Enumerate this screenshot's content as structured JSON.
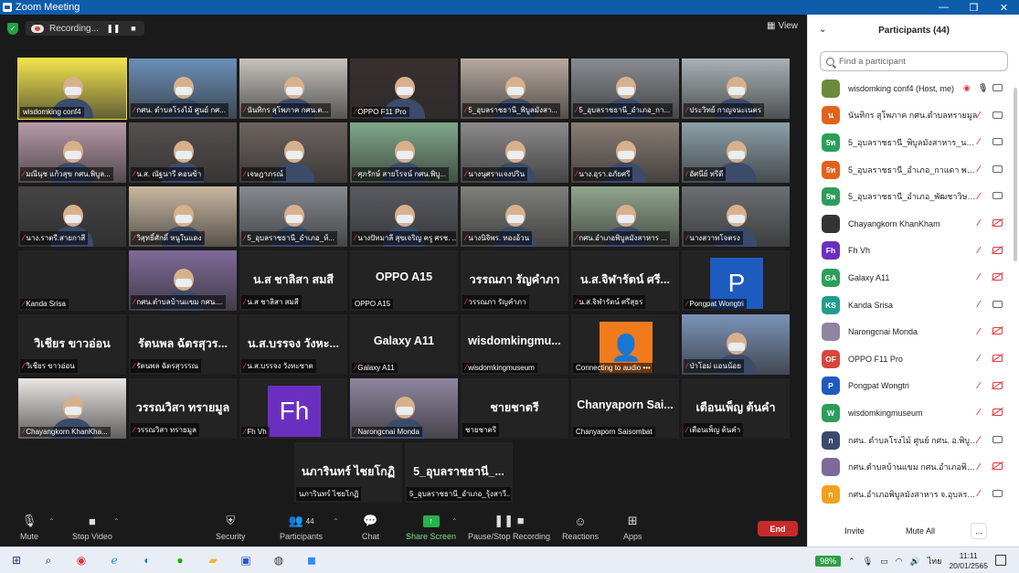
{
  "window": {
    "title": "Zoom Meeting",
    "controls": [
      "—",
      "❐",
      "✕"
    ]
  },
  "recording": {
    "label": "Recording..."
  },
  "view_button": {
    "label": "View"
  },
  "tiles": [
    {
      "name": "wisdomking conf4",
      "kind": "video",
      "bg": "#f2e44e",
      "active": true,
      "muted": false
    },
    {
      "name": "กศน. ตำบลโรงไม้ ศูนย์ กศ...",
      "kind": "video",
      "bg": "#6a8fb8",
      "muted": true
    },
    {
      "name": "นันทิกร สุโพภาค กศน.ต...",
      "kind": "video",
      "bg": "#c6c3bd",
      "muted": true
    },
    {
      "name": "OPPO F11 Pro",
      "kind": "video",
      "bg": "#3a2f2f",
      "muted": true
    },
    {
      "name": "5_อุบลราชธานี_พิบูลมังสา...",
      "kind": "video",
      "bg": "#b8aaa0",
      "muted": true
    },
    {
      "name": "5_อุบลราชธานี_อำเภอ_กา...",
      "kind": "video",
      "bg": "#8a8c93",
      "muted": true
    },
    {
      "name": "ประวิทย์ กาญจนะเนตร",
      "kind": "video",
      "bg": "#a9b2b7",
      "muted": true
    },
    {
      "name": "มณีนุช แก้วสุข กศน.พิบูล...",
      "kind": "video",
      "bg": "#b89aa9",
      "muted": true
    },
    {
      "name": "น.ส. ณัฐนารี คอนข้า",
      "kind": "video",
      "bg": "#565050",
      "muted": true
    },
    {
      "name": "เจษฎาภรณ์",
      "kind": "video",
      "bg": "#6d6360",
      "muted": true
    },
    {
      "name": "ศุภรักษ์ สายโรจน์ กศน.พิบู...",
      "kind": "video",
      "bg": "#7fa88a",
      "muted": true
    },
    {
      "name": "นางนุศราแจงปริน",
      "kind": "video",
      "bg": "#8c8a8a",
      "muted": true
    },
    {
      "name": "นาง.อุรา.อภัยศรี",
      "kind": "video",
      "bg": "#8a7d74",
      "muted": true
    },
    {
      "name": "อัศนีย์ หรีดี",
      "kind": "video",
      "bg": "#8da0a8",
      "muted": true
    },
    {
      "name": "นาง.ราตรี.สายกาสี",
      "kind": "video",
      "bg": "#454444",
      "muted": true
    },
    {
      "name": "วิสุทธิ์ศักดิ์ หนูในแดง",
      "kind": "video",
      "bg": "#c8b7a0",
      "muted": true
    },
    {
      "name": "5_อุบลราชธานี_อำเภอ_ห้...",
      "kind": "video",
      "bg": "#878a90",
      "muted": true
    },
    {
      "name": "นางปัทมาลี สุขเจริญ ครู ศรช. ...",
      "kind": "video",
      "bg": "#5a5c62",
      "muted": true
    },
    {
      "name": "นางนิจิพร. ทองอ้วน",
      "kind": "video",
      "bg": "#7f7f7c",
      "muted": true
    },
    {
      "name": "กศน.อำเภอพิบูลมังสาหาร ...",
      "kind": "video",
      "bg": "#90a68e",
      "muted": true
    },
    {
      "name": "นางสวาทโจตรง",
      "kind": "video",
      "bg": "#6c6f73",
      "muted": true
    },
    {
      "name": "Kanda Srisa",
      "kind": "blank",
      "muted": true
    },
    {
      "name": "กศน.ตำบลบ้านแขม กศน....",
      "kind": "video",
      "bg": "#7e6a99",
      "muted": true
    },
    {
      "name": "น.ส ชาลิสา สมสี",
      "kind": "text",
      "big": "น.ส ชาลิสา สมสี",
      "muted": true
    },
    {
      "name": "OPPO A15",
      "kind": "text",
      "big": "OPPO A15",
      "muted": false
    },
    {
      "name": "วรรณภา รัญคำภา",
      "kind": "text",
      "big": "วรรณภา รัญคำภา",
      "muted": true
    },
    {
      "name": "น.ส.จิฬารัตน์ ศรีสุธร",
      "kind": "text",
      "big": "น.ส.จิฬารัตน์ ศรี...",
      "muted": true
    },
    {
      "name": "Pongpat Wongtri",
      "kind": "avatar",
      "letter": "P",
      "bg": "#1d5bbf",
      "muted": true
    },
    {
      "name": "วิเชียร ขาวอ่อน",
      "kind": "text",
      "big": "วิเชียร ขาวอ่อน",
      "muted": true
    },
    {
      "name": "รัตนพล ฉัตรสุวรรณ",
      "kind": "text",
      "big": "รัตนพล ฉัตรสุวร...",
      "muted": true
    },
    {
      "name": "น.ส.บรรจง วังหะซาต",
      "kind": "text",
      "big": "น.ส.บรรจง วังหะ...",
      "muted": true
    },
    {
      "name": "Galaxy A11",
      "kind": "text",
      "big": "Galaxy A11",
      "muted": true
    },
    {
      "name": "wisdomkingmuseum",
      "kind": "text",
      "big": "wisdomkingmu...",
      "muted": true
    },
    {
      "name": "Connecting to audio •••",
      "kind": "avatar",
      "letter": "👤",
      "bg": "#f07b1c",
      "muted": false
    },
    {
      "name": "ป่าโอม่ แอนน้อย",
      "kind": "video",
      "bg": "#7b93b8",
      "muted": true
    },
    {
      "name": "Chayangkorn KhanKha...",
      "kind": "video",
      "bg": "#e9e6e3",
      "muted": true
    },
    {
      "name": "วรรณวิสา ทรายมูล",
      "kind": "text",
      "big": "วรรณวิสา ทรายมูล",
      "muted": true
    },
    {
      "name": "Fh Vh",
      "kind": "avatar",
      "letter": "Fh",
      "bg": "#6b2fbf",
      "muted": true
    },
    {
      "name": "Narongcnai Monda",
      "kind": "video",
      "bg": "#8e86a0",
      "muted": true
    },
    {
      "name": "ชายชาตรี",
      "kind": "text",
      "big": "ชายชาตรี",
      "muted": false
    },
    {
      "name": "Chanyaporn Saisombat",
      "kind": "text",
      "big": "Chanyaporn Sai...",
      "muted": false
    },
    {
      "name": "เตือนเพ็ญ ต้นคำ",
      "kind": "text",
      "big": "เตือนเพ็ญ ต้นคำ",
      "muted": true
    },
    {
      "name": "นภารินทร์ ไชยโกฏิ",
      "kind": "text",
      "big": "นภารินทร์ ไชยโกฏิ",
      "muted": false
    },
    {
      "name": "5_อุบลราชธานี_อำเภอ_รุ้งสาวี...",
      "kind": "text",
      "big": "5_อุบลราชธานี_...",
      "muted": false
    }
  ],
  "toolbar": {
    "mute": "Mute",
    "stop_video": "Stop Video",
    "security": "Security",
    "participants": "Participants",
    "participants_count": "44",
    "chat": "Chat",
    "share_screen": "Share Screen",
    "pause_stop_recording": "Pause/Stop Recording",
    "reactions": "Reactions",
    "apps": "Apps",
    "end": "End"
  },
  "panel": {
    "title": "Participants (44)",
    "search_placeholder": "Find a participant",
    "invite": "Invite",
    "mute_all": "Mute All",
    "more": "...",
    "participants": [
      {
        "initials": "",
        "name": "wisdomking conf4 (Host, me)",
        "color": "#6c8a3c",
        "mic": "on",
        "cam": "on",
        "recording": true
      },
      {
        "initials": "น",
        "name": "นันทิกร สุโพภาค กศน.ตำบลทรายมูล",
        "color": "#e2621b",
        "mic": "off",
        "cam": "on"
      },
      {
        "initials": "5ท",
        "name": "5_อุบลราชธานี_พิบูลมังสาหาร_นางสา...",
        "color": "#2c9e5a",
        "mic": "off",
        "cam": "on"
      },
      {
        "initials": "5ท",
        "name": "5_อุบลราชธานี_อำเภอ_กาแดา พงศ์ส...",
        "color": "#e2621b",
        "mic": "off",
        "cam": "on"
      },
      {
        "initials": "5พ",
        "name": "5_อุบลราชธานี_อำเภอ_พัฒชาวิษฑฤ...",
        "color": "#2c9e5a",
        "mic": "off",
        "cam": "on"
      },
      {
        "initials": "",
        "name": "Chayangkorn KhanKham",
        "color": "#333333",
        "mic": "off",
        "cam": "off"
      },
      {
        "initials": "Fh",
        "name": "Fh Vh",
        "color": "#6b2fbf",
        "mic": "off",
        "cam": "off"
      },
      {
        "initials": "GA",
        "name": "Galaxy A11",
        "color": "#2c9e5a",
        "mic": "off",
        "cam": "off"
      },
      {
        "initials": "KS",
        "name": "Kanda Srisa",
        "color": "#1f9e8c",
        "mic": "off",
        "cam": "on"
      },
      {
        "initials": "",
        "name": "Narongcnai Monda",
        "color": "#8e86a0",
        "mic": "off",
        "cam": "off"
      },
      {
        "initials": "OF",
        "name": "OPPO F11 Pro",
        "color": "#d9453d",
        "mic": "off",
        "cam": "off"
      },
      {
        "initials": "P",
        "name": "Pongpat Wongtri",
        "color": "#1d5bbf",
        "mic": "off",
        "cam": "off"
      },
      {
        "initials": "W",
        "name": "wisdomkingmuseum",
        "color": "#2c9e5a",
        "mic": "off",
        "cam": "off"
      },
      {
        "initials": "ก",
        "name": "กศน. ตำบลโรงไม้ ศูนย์ กศน. อ.พิบูลฯ จ...",
        "color": "#3b4a6b",
        "mic": "off",
        "cam": "on"
      },
      {
        "initials": "",
        "name": "กศน.ตำบลบ้านแขม กศน.อำเภอพิบูลมั...",
        "color": "#7e6a99",
        "mic": "off",
        "cam": "off"
      },
      {
        "initials": "ก",
        "name": "กศน.อำเภอพิบูลมังสาหาร จ.อุบลราชธ...",
        "color": "#f0a21c",
        "mic": "off",
        "cam": "on"
      }
    ]
  },
  "taskbar": {
    "battery": "98%",
    "language": "ไทย",
    "time": "11:11",
    "date": "20/01/2565"
  }
}
